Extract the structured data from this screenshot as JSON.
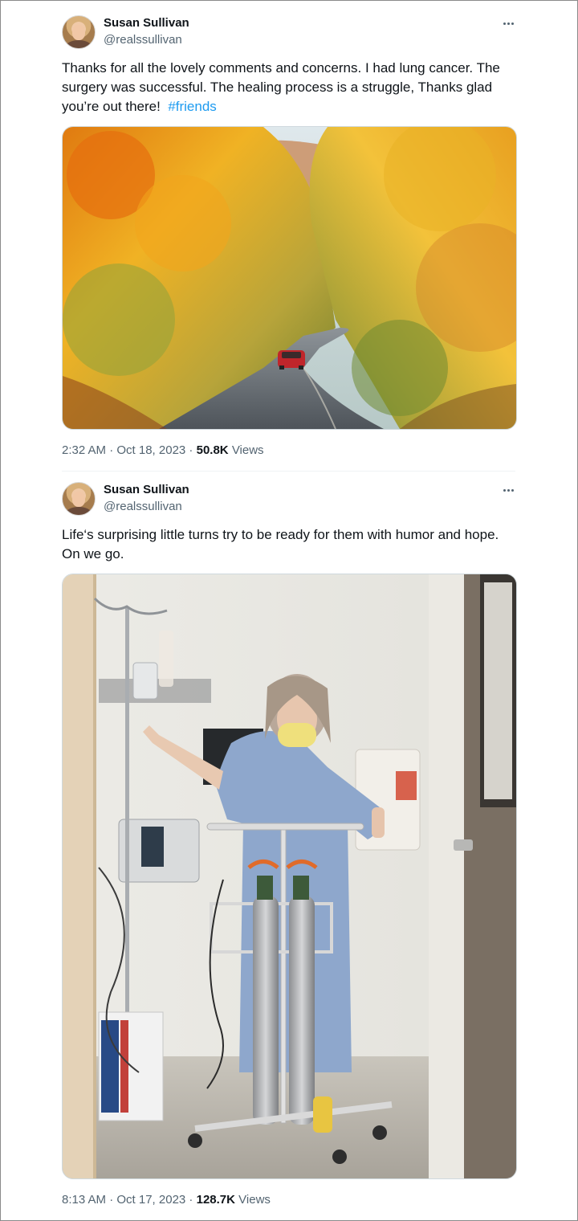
{
  "tweets": [
    {
      "author": {
        "name": "Susan Sullivan",
        "handle": "@realssullivan"
      },
      "text_lines": [
        "Thanks for all the lovely comments and concerns. I had lung cancer. The",
        "surgery was successful. The healing process is a struggle,  Thanks glad",
        "you’re out there!"
      ],
      "hashtag": "#friends",
      "media": {
        "subject": "autumn forest road with red car"
      },
      "time": "2:32 AM · Oct 18, 2023",
      "sep": " · ",
      "views_count": "50.8K",
      "views_label": "Views"
    },
    {
      "author": {
        "name": "Susan Sullivan",
        "handle": "@realssullivan"
      },
      "text_lines": [
        "Life‘s surprising little turns try to be ready for them with humor and hope.",
        "On we go."
      ],
      "media": {
        "subject": "woman in hospital gown with IV stand and oxygen cart"
      },
      "time": "8:13 AM · Oct 17, 2023",
      "sep": " · ",
      "views_count": "128.7K",
      "views_label": "Views"
    }
  ],
  "icons": {
    "more": "more-horizontal-icon",
    "avatar": "avatar-image"
  },
  "colors": {
    "link": "#1d9bf0",
    "secondary": "#536471",
    "primary": "#0f1419"
  }
}
